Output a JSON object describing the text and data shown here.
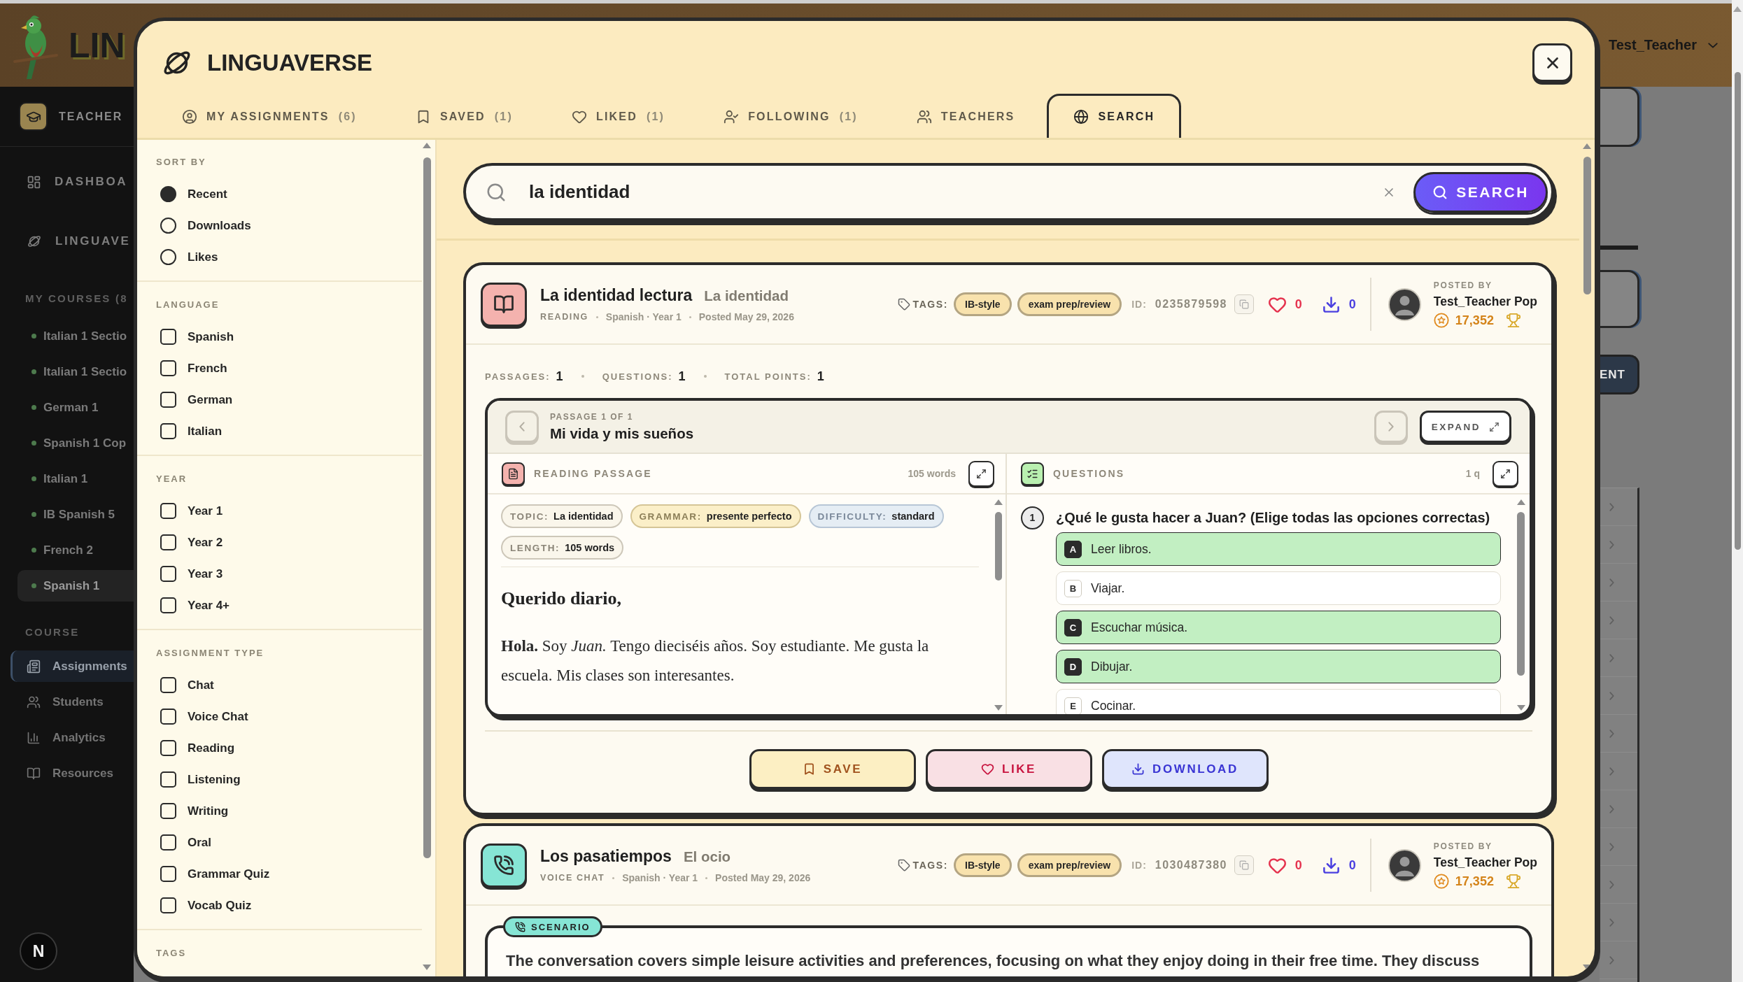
{
  "app": {
    "logo": "LIN",
    "user": "Test_Teacher",
    "role": "TEACHER",
    "nav": [
      {
        "label": "DASHBOA"
      },
      {
        "label": "LINGUAVE"
      }
    ],
    "courses_heading": "MY COURSES (8",
    "courses": [
      {
        "name": "Italian 1 Sectio",
        "selected": false
      },
      {
        "name": "Italian 1 Sectio",
        "selected": false
      },
      {
        "name": "German 1",
        "selected": false
      },
      {
        "name": "Spanish 1 Cop",
        "selected": false
      },
      {
        "name": "Italian 1",
        "selected": false
      },
      {
        "name": "IB Spanish 5",
        "selected": false
      },
      {
        "name": "French 2",
        "selected": false
      },
      {
        "name": "Spanish 1",
        "selected": true
      }
    ],
    "course_heading": "COURSE",
    "course_nav": [
      {
        "label": "Assignments",
        "selected": true
      },
      {
        "label": "Students",
        "selected": false
      },
      {
        "label": "Analytics",
        "selected": false
      },
      {
        "label": "Resources",
        "selected": false
      }
    ],
    "initial": "N",
    "side_button": "ENT"
  },
  "modal": {
    "title": "LINGUAVERSE",
    "tabs": [
      {
        "label": "MY ASSIGNMENTS",
        "count": "(6)",
        "selected": false
      },
      {
        "label": "SAVED",
        "count": "(1)",
        "selected": false
      },
      {
        "label": "LIKED",
        "count": "(1)",
        "selected": false
      },
      {
        "label": "FOLLOWING",
        "count": "(1)",
        "selected": false
      },
      {
        "label": "TEACHERS",
        "selected": false
      },
      {
        "label": "SEARCH",
        "selected": true
      }
    ]
  },
  "filters": {
    "sections": [
      {
        "heading": "SORT BY",
        "kind": "radio",
        "options": [
          {
            "label": "Recent",
            "selected": true
          },
          {
            "label": "Downloads",
            "selected": false
          },
          {
            "label": "Likes",
            "selected": false
          }
        ]
      },
      {
        "heading": "LANGUAGE",
        "kind": "checkbox",
        "options": [
          {
            "label": "Spanish",
            "checked": false
          },
          {
            "label": "French",
            "checked": false
          },
          {
            "label": "German",
            "checked": false
          },
          {
            "label": "Italian",
            "checked": false
          }
        ]
      },
      {
        "heading": "YEAR",
        "kind": "checkbox",
        "options": [
          {
            "label": "Year 1",
            "checked": false
          },
          {
            "label": "Year 2",
            "checked": false
          },
          {
            "label": "Year 3",
            "checked": false
          },
          {
            "label": "Year 4+",
            "checked": false
          }
        ]
      },
      {
        "heading": "ASSIGNMENT TYPE",
        "kind": "checkbox",
        "options": [
          {
            "label": "Chat",
            "checked": false
          },
          {
            "label": "Voice Chat",
            "checked": false
          },
          {
            "label": "Reading",
            "checked": false
          },
          {
            "label": "Listening",
            "checked": false
          },
          {
            "label": "Writing",
            "checked": false
          },
          {
            "label": "Oral",
            "checked": false
          },
          {
            "label": "Grammar Quiz",
            "checked": false
          },
          {
            "label": "Vocab Quiz",
            "checked": false
          }
        ]
      },
      {
        "heading": "TAGS"
      }
    ]
  },
  "search": {
    "value": "la identidad",
    "button": "SEARCH"
  },
  "results": [
    {
      "kind": "reading",
      "title": "La identidad lectura",
      "subtitle": "La identidad",
      "type_label": "READING",
      "details": [
        "Spanish · Year 1",
        "Posted May 29, 2026"
      ],
      "tags_label": "TAGS:",
      "tags": [
        "IB-style",
        "exam prep/review"
      ],
      "id_label": "ID:",
      "id": "0235879598",
      "likes": "0",
      "downloads": "0",
      "posted_by_label": "POSTED BY",
      "author": "Test_Teacher Pop",
      "points": "17,352",
      "stats": [
        {
          "label": "PASSAGES:",
          "value": "1"
        },
        {
          "label": "QUESTIONS:",
          "value": "1"
        },
        {
          "label": "TOTAL POINTS:",
          "value": "1"
        }
      ],
      "passage": {
        "counter": "PASSAGE 1 OF 1",
        "title": "Mi vida y mis sueños",
        "prev": {
          "disabled": true
        },
        "next": {
          "disabled": true
        },
        "expand": "EXPAND",
        "reading_label": "READING PASSAGE",
        "word_count": "105 words",
        "chips": [
          {
            "kind": "topic",
            "label": "TOPIC:",
            "value": "La identidad"
          },
          {
            "kind": "grammar",
            "label": "GRAMMAR:",
            "value": "presente perfecto"
          },
          {
            "kind": "difficulty",
            "label": "DIFFICULTY:",
            "value": "standard"
          },
          {
            "kind": "length",
            "label": "LENGTH:",
            "value": "105 words"
          }
        ],
        "greeting": "Querido diario,",
        "body": "**Hola.** Soy *Juan.* Tengo dieciséis años. Soy estudiante. Me gusta la escuela. Mis clases son interesantes.",
        "questions_label": "QUESTIONS",
        "question_count": "1 q",
        "questions": [
          {
            "number": "1",
            "text": "¿Qué le gusta hacer a Juan? (Elige todas las opciones correctas)",
            "options": [
              {
                "letter": "A",
                "text": "Leer libros.",
                "correct": true
              },
              {
                "letter": "B",
                "text": "Viajar.",
                "correct": false
              },
              {
                "letter": "C",
                "text": "Escuchar música.",
                "correct": true
              },
              {
                "letter": "D",
                "text": "Dibujar.",
                "correct": true
              },
              {
                "letter": "E",
                "text": "Cocinar.",
                "correct": false
              }
            ]
          }
        ]
      },
      "actions": [
        {
          "kind": "save",
          "label": "SAVE"
        },
        {
          "kind": "like",
          "label": "LIKE"
        },
        {
          "kind": "download",
          "label": "DOWNLOAD"
        }
      ]
    },
    {
      "kind": "voice_chat",
      "title": "Los pasatiempos",
      "subtitle": "El ocio",
      "type_label": "VOICE CHAT",
      "details": [
        "Spanish · Year 1",
        "Posted May 29, 2026"
      ],
      "tags_label": "TAGS:",
      "tags": [
        "IB-style",
        "exam prep/review"
      ],
      "id_label": "ID:",
      "id": "1030487380",
      "likes": "0",
      "downloads": "0",
      "posted_by_label": "POSTED BY",
      "author": "Test_Teacher Pop",
      "points": "17,352",
      "scenario": {
        "label": "SCENARIO",
        "text": "The conversation covers simple leisure activities and preferences, focusing on what they enjoy doing in their free time. They discuss"
      }
    }
  ]
}
